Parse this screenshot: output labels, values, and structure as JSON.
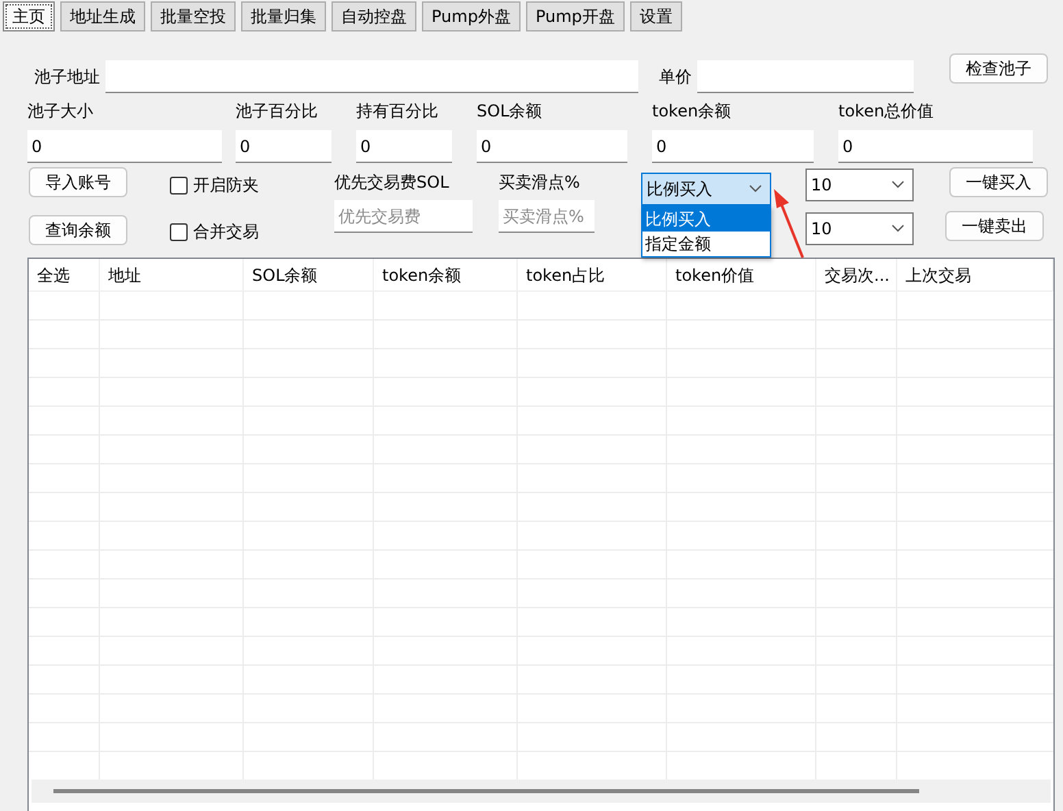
{
  "tabs": [
    {
      "label": "主页",
      "selected": true
    },
    {
      "label": "地址生成",
      "selected": false
    },
    {
      "label": "批量空投",
      "selected": false
    },
    {
      "label": "批量归集",
      "selected": false
    },
    {
      "label": "自动控盘",
      "selected": false
    },
    {
      "label": "Pump外盘",
      "selected": false
    },
    {
      "label": "Pump开盘",
      "selected": false
    },
    {
      "label": "设置",
      "selected": false
    }
  ],
  "pool_address": {
    "label": "池子地址"
  },
  "unit_price": {
    "label": "单价"
  },
  "check_pool_button": "检查池子",
  "stats": [
    {
      "label": "池子大小",
      "value": "0"
    },
    {
      "label": "池子百分比",
      "value": "0"
    },
    {
      "label": "持有百分比",
      "value": "0"
    },
    {
      "label": "SOL余额",
      "value": "0"
    },
    {
      "label": "token余额",
      "value": "0"
    },
    {
      "label": "token总价值",
      "value": "0"
    }
  ],
  "import_button": "导入账号",
  "query_button": "查询余额",
  "checkboxes": [
    {
      "label": "开启防夹",
      "checked": false
    },
    {
      "label": "合并交易",
      "checked": false
    }
  ],
  "priority_fee": {
    "label": "优先交易费SOL",
    "placeholder": "优先交易费"
  },
  "slippage": {
    "label": "买卖滑点%",
    "placeholder": "买卖滑点%"
  },
  "buy_mode": {
    "value": "比例买入",
    "expanded": true,
    "options": [
      {
        "label": "比例买入",
        "selected": true
      },
      {
        "label": "指定金额",
        "selected": false
      }
    ]
  },
  "buy_amount": {
    "value": "10"
  },
  "sell_amount": {
    "value": "10"
  },
  "buy_button": "一键买入",
  "sell_button": "一键卖出",
  "table": {
    "columns": [
      "全选",
      "地址",
      "SOL余额",
      "token余额",
      "token占比",
      "token价值",
      "交易次...",
      "上次交易"
    ]
  }
}
